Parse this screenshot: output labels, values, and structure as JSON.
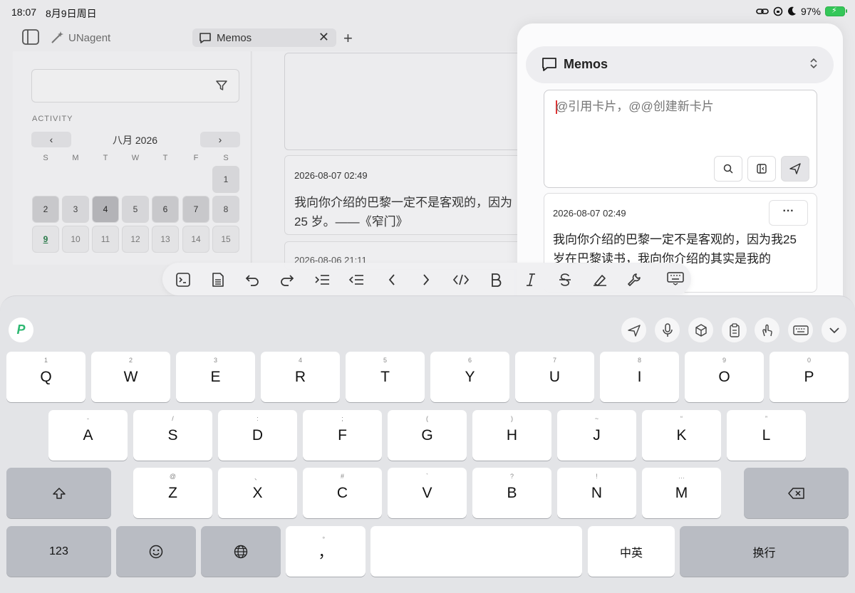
{
  "status_bar": {
    "time": "18:07",
    "date": "8月9日周日",
    "battery": "97%"
  },
  "tabs": {
    "app_name": "UNagent",
    "active_tab": "Memos",
    "close_glyph": "✕",
    "add_glyph": "+"
  },
  "sidebar": {
    "activity_label": "ACTIVITY",
    "calendar": {
      "title": "八月 2026",
      "prev": "‹",
      "next": "›",
      "weekdays": [
        "S",
        "M",
        "T",
        "W",
        "T",
        "F",
        "S"
      ],
      "days": [
        {
          "d": "1",
          "level": 1
        },
        {
          "d": "2",
          "level": 2
        },
        {
          "d": "3",
          "level": 1
        },
        {
          "d": "4",
          "level": 3
        },
        {
          "d": "5",
          "level": 1
        },
        {
          "d": "6",
          "level": 2
        },
        {
          "d": "7",
          "level": 2
        },
        {
          "d": "8",
          "level": 1
        },
        {
          "d": "9",
          "level": 0
        },
        {
          "d": "10",
          "level": 0
        },
        {
          "d": "11",
          "level": 0
        },
        {
          "d": "12",
          "level": 0
        },
        {
          "d": "13",
          "level": 0
        },
        {
          "d": "14",
          "level": 0
        },
        {
          "d": "15",
          "level": 0
        }
      ]
    }
  },
  "middle": {
    "card1": {
      "timestamp": "2026-08-07 02:49",
      "text_line1": "我向你介绍的巴黎一定不是客观的，因为",
      "text_line2": "25 岁。——《窄门》"
    },
    "card2": {
      "timestamp": "2026-08-06 21:11"
    }
  },
  "panel": {
    "title": "Memos",
    "composer_placeholder": "@引用卡片，@@创建新卡片",
    "card": {
      "timestamp": "2026-08-07 02:49",
      "more": "···",
      "text": "我向你介绍的巴黎一定不是客观的，因为我25 岁在巴黎读书，我向你介绍的其实是我的"
    }
  },
  "toolbar": {
    "items": [
      "terminal-icon",
      "document-icon",
      "undo-icon",
      "redo-icon",
      "indent-icon",
      "outdent-icon",
      "arrow-left-icon",
      "arrow-right-icon",
      "code-icon",
      "bold-icon",
      "italic-icon",
      "strikethrough-icon",
      "highlight-icon",
      "wrench-icon",
      "keyboard-hide-icon"
    ]
  },
  "keyboard": {
    "row1": [
      {
        "k": "Q",
        "s": "1"
      },
      {
        "k": "W",
        "s": "2"
      },
      {
        "k": "E",
        "s": "3"
      },
      {
        "k": "R",
        "s": "4"
      },
      {
        "k": "T",
        "s": "5"
      },
      {
        "k": "Y",
        "s": "6"
      },
      {
        "k": "U",
        "s": "7"
      },
      {
        "k": "I",
        "s": "8"
      },
      {
        "k": "O",
        "s": "9"
      },
      {
        "k": "P",
        "s": "0"
      }
    ],
    "row2": [
      {
        "k": "A",
        "s": "-"
      },
      {
        "k": "S",
        "s": "/"
      },
      {
        "k": "D",
        "s": ":"
      },
      {
        "k": "F",
        "s": ";"
      },
      {
        "k": "G",
        "s": "("
      },
      {
        "k": "H",
        "s": ")"
      },
      {
        "k": "J",
        "s": "~"
      },
      {
        "k": "K",
        "s": "“"
      },
      {
        "k": "L",
        "s": "”"
      }
    ],
    "row3": [
      {
        "k": "Z",
        "s": "@"
      },
      {
        "k": "X",
        "s": "、"
      },
      {
        "k": "C",
        "s": "#"
      },
      {
        "k": "V",
        "s": "`"
      },
      {
        "k": "B",
        "s": "?"
      },
      {
        "k": "N",
        "s": "!"
      },
      {
        "k": "M",
        "s": "…"
      }
    ],
    "numbers_label": "123",
    "comma_key": "，",
    "comma_sub": "。",
    "lang_switch": "中英",
    "return_label": "换行",
    "logo": "P",
    "tools": [
      "send-icon",
      "mic-icon",
      "cube-icon",
      "clipboard-icon",
      "gesture-icon",
      "keyboard-icon",
      "chevron-down-icon"
    ]
  }
}
